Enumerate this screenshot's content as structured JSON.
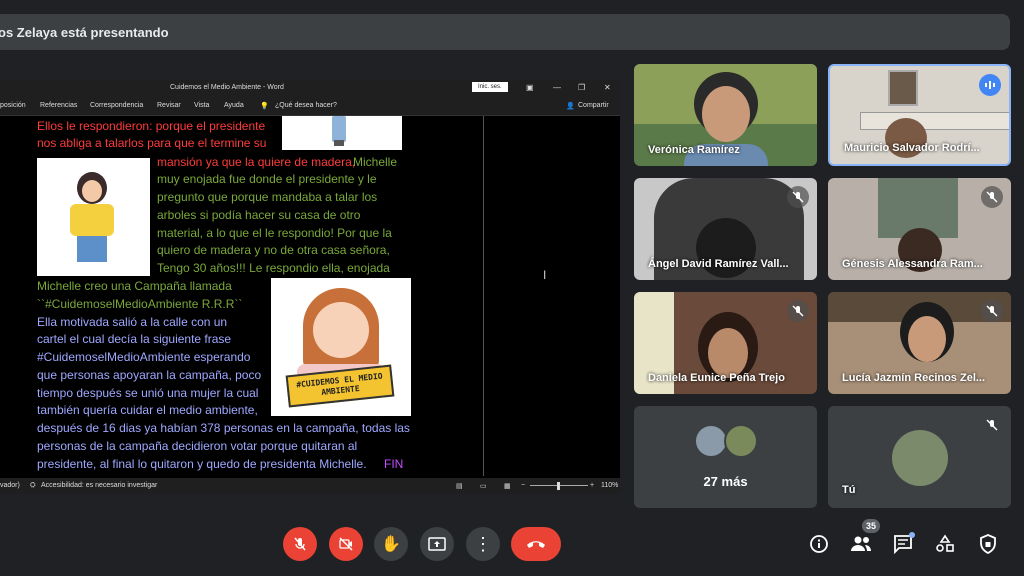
{
  "header": {
    "presenting_text": "os Zelaya está presentando"
  },
  "word": {
    "title": "Cuidemos el Medio Ambiente  -  Word",
    "signin": "Inic. ses.",
    "ribbon": [
      "posición",
      "Referencias",
      "Correspondencia",
      "Revisar",
      "Vista",
      "Ayuda"
    ],
    "tell_me": "¿Qué desea hacer?",
    "share": "Compartir",
    "status_left": "vador)",
    "accessibility": "Accesibilidad: es necesario investigar",
    "zoom": "110%",
    "poster_text": "#CUIDEMOS EL MEDIO AMBIENTE",
    "lines": [
      "Ellos le respondieron: porque el presidente",
      "nos abliga a talarlos para que el termine su",
      "mansión ya que la quiere de madera,",
      " Michelle",
      "muy enojada fue donde el presidente y le",
      "pregunto que porque mandaba a talar los",
      "arboles si podía hacer su casa de otro",
      "material, a lo que el le respondio! Por que la",
      "quiero de madera y no de otra casa señora,",
      "Tengo 30 años!!! Le respondio ella, enojada",
      "Michelle creo una Campaña llamada",
      "``#CuidemoselMedioAmbiente R.R.R``",
      "Ella motivada salió a la calle con un",
      "cartel el cual decía la siguiente frase",
      "#CuidemoselMedioAmbiente esperando",
      "que personas apoyaran la campaña, poco",
      "tiempo después se unió una mujer la cual",
      "también quería cuidar el medio ambiente,",
      "después de 16 dias ya habían 378 personas en la campaña, todas las",
      "personas de la campaña decidieron votar porque quitaran al",
      "presidente, al final lo quitaron y quedo de presidenta Michelle.",
      "FIN"
    ]
  },
  "participants": [
    {
      "name": "Verónica Ramírez",
      "muted": false
    },
    {
      "name": "Mauricio Salvador Rodrí...",
      "muted": false,
      "speaking": true
    },
    {
      "name": "Ángel David Ramírez Vall...",
      "muted": true
    },
    {
      "name": "Génesis Alessandra Ram...",
      "muted": true
    },
    {
      "name": "Daniela Eunice Peña Trejo",
      "muted": true
    },
    {
      "name": "Lucía Jazmín Recinos Zel...",
      "muted": true
    }
  ],
  "more": {
    "label": "27 más"
  },
  "self": {
    "label": "Tú"
  },
  "controls": {
    "people_count": "35"
  },
  "colors": {
    "background": "#202124",
    "tile": "#3c4043",
    "danger": "#ea4335",
    "speaking": "#4285f4"
  }
}
